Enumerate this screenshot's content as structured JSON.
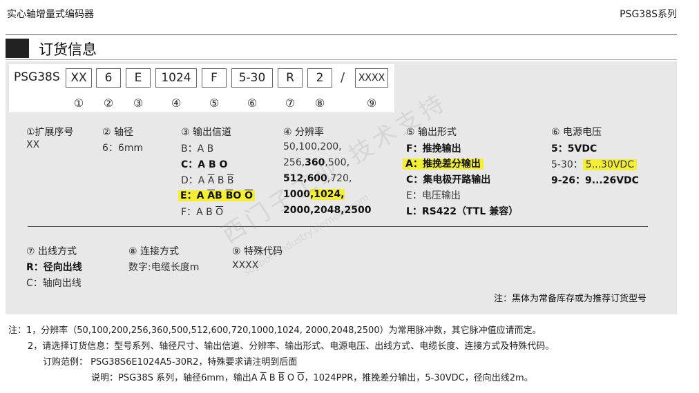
{
  "header": {
    "left": "实心轴增量式编码器",
    "right": "PSG38S系列"
  },
  "section": {
    "title": "订货信息"
  },
  "code": {
    "model": "PSG38S",
    "cells": [
      "XX",
      "6",
      "E",
      "1024",
      "F",
      "5-30",
      "R",
      "2",
      "XXXX"
    ],
    "slash": "/",
    "numbers": [
      "①",
      "②",
      "③",
      "④",
      "⑤",
      "⑥",
      "⑦",
      "⑧",
      "⑨"
    ]
  },
  "columns": {
    "c1": {
      "title": "①扩展序号",
      "items": [
        "XX"
      ]
    },
    "c2": {
      "title": "② 轴径",
      "items": [
        "6：6mm"
      ]
    },
    "c3": {
      "title": "③ 输出信道",
      "items": [
        {
          "pre": "B：",
          "a": "A ",
          "b": "B"
        },
        {
          "pre": "C：",
          "a": "A B O"
        },
        {
          "pre": "D：",
          "a": "A ",
          "b": "A",
          "c": " B ",
          "d": "B"
        },
        {
          "pre": "E：",
          "a": "A ",
          "b": "A",
          "c": "B ",
          "d": "B",
          "e": "O ",
          "f": "O"
        },
        {
          "pre": "F：",
          "a": "A B ",
          "b": "O"
        }
      ]
    },
    "c4": {
      "title": "④ 分辨率",
      "l1": "50,100,200,",
      "l2a": "256,",
      "l2b": "360",
      "l2c": ",500,",
      "l3a": "512",
      "l3b": ",",
      "l3c": "600",
      "l3d": ",720,",
      "l4a": "1000",
      "l4b": ",1024,",
      "l5": "2000,2048,2500"
    },
    "c5": {
      "title": "⑤ 输出形式",
      "items": [
        "F：推挽输出",
        "A：推挽差分输出",
        "C：集电极开路输出",
        "E：电压输出",
        "L：RS422（TTL 兼容）"
      ]
    },
    "c6": {
      "title": "⑥ 电源电压",
      "l1": "5：5VDC",
      "l2a": "5-30：",
      "l2b": "5...30VDC",
      "l3": "9-26：9...26VDC"
    },
    "c7": {
      "title": "⑦ 出线方式",
      "items": [
        "R：径向出线",
        "C：轴向出线"
      ]
    },
    "c8": {
      "title": "⑧ 连接方式",
      "items": [
        "数字:电缆长度m"
      ]
    },
    "c9": {
      "title": "⑨ 特殊代码",
      "items": [
        "XXXX"
      ]
    }
  },
  "note_right": "注：黑体为常备库存或为推荐订货型号",
  "footnotes": {
    "f1": "注：1，分辨率（50,100,200,256,360,500,512,600,720,1000,1024, 2000,2048,2500）为常用脉冲数，其它脉冲值应请而定。",
    "f2": "2，请选择订货信息：型号系列、轴径尺寸、输出信道、分辨率、输出形式、电源电压、出线方式、电缆长度、连接方式及特殊代码。",
    "f3": "订购范例：   PSG38S6E1024A5-30R2，特殊要求请注明到后面",
    "f4a": "说明：PSG38S 系列，轴径6mm，输出",
    "f4b": "A ",
    "f4c": "A",
    "f4d": " B ",
    "f4e": "B",
    "f4f": " O ",
    "f4g": "O",
    "f4h": "，1024PPR，推挽差分输出，5-30VDC，径向出线2m。"
  },
  "watermark": {
    "main": "西门子工业 技术支持",
    "sub": "support.industry.siemens.com"
  }
}
